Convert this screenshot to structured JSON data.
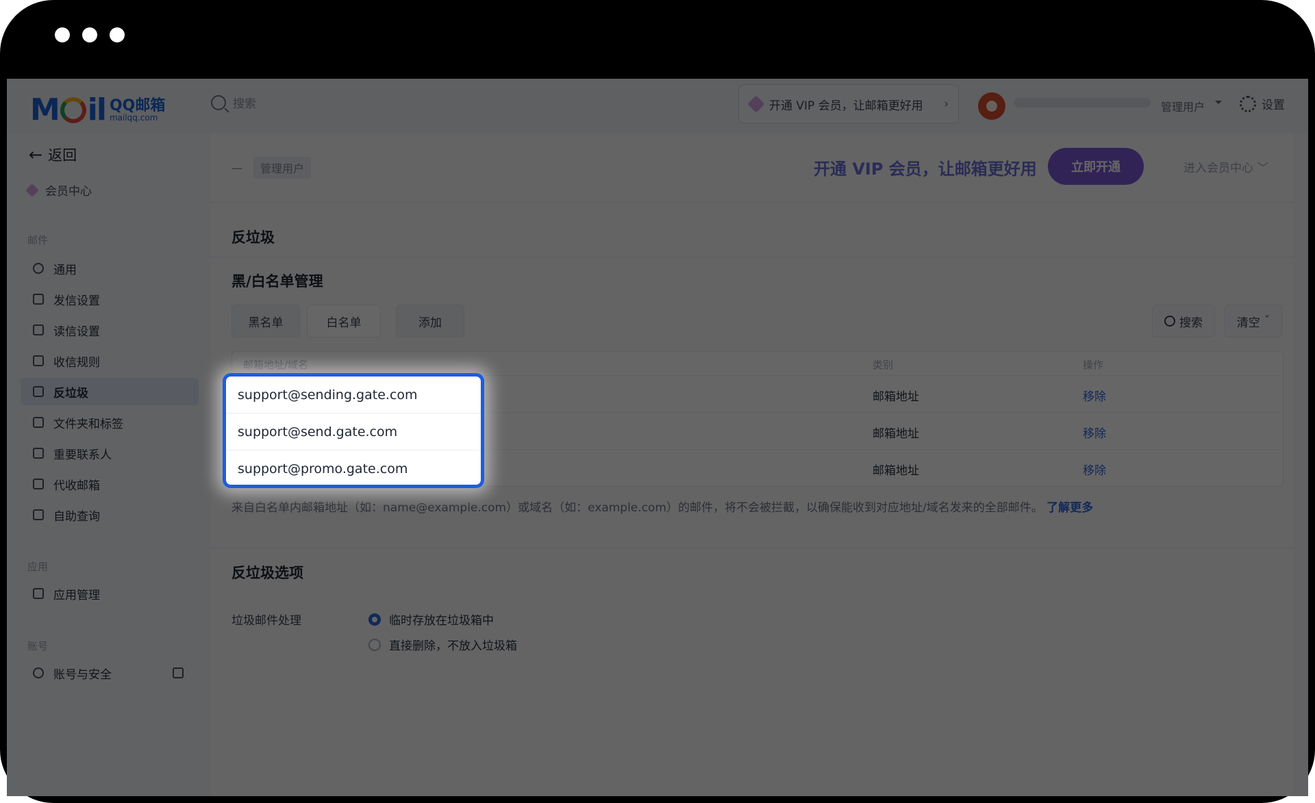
{
  "window": {
    "dots": 3
  },
  "topbar": {
    "logo_text": "M",
    "logo_text_end": "il",
    "logo_qq": "QQ邮箱",
    "logo_sub": "mailqq.com",
    "search_placeholder": "搜索",
    "vip_pill": "开通 VIP 会员，让邮箱更好用",
    "admin_label": "管理用户",
    "settings_label": "设置"
  },
  "sidebar": {
    "back_label": "返回",
    "member_center": "会员中心",
    "sections": {
      "mail": "邮件",
      "apps": "应用",
      "account": "账号"
    },
    "items": [
      {
        "label": "通用"
      },
      {
        "label": "发信设置"
      },
      {
        "label": "读信设置"
      },
      {
        "label": "收信规则"
      },
      {
        "label": "反垃圾"
      },
      {
        "label": "文件夹和标签"
      },
      {
        "label": "重要联系人"
      },
      {
        "label": "代收邮箱"
      },
      {
        "label": "自助查询"
      }
    ],
    "app_items": [
      {
        "label": "应用管理"
      }
    ],
    "account_items": [
      {
        "label": "账号与安全"
      }
    ]
  },
  "main": {
    "breadcrumb": "管理用户",
    "vip_promo": "开通 VIP 会员，让邮箱更好用",
    "vip_button": "立即开通",
    "vip_center": "进入会员中心",
    "page_title": "反垃圾",
    "section_list_title": "黑/白名单管理",
    "tabs": {
      "blacklist": "黑名单",
      "whitelist": "白名单",
      "add": "添加"
    },
    "search_button": "搜索",
    "clear_button": "清空",
    "table": {
      "headers": {
        "address": "邮箱地址/域名",
        "type": "类别",
        "action": "操作"
      },
      "rows": [
        {
          "address": "support@sending.gate.com",
          "type": "邮箱地址",
          "action": "移除"
        },
        {
          "address": "support@send.gate.com",
          "type": "邮箱地址",
          "action": "移除"
        },
        {
          "address": "support@promo.gate.com",
          "type": "邮箱地址",
          "action": "移除"
        }
      ]
    },
    "hint_text": "来自白名单内邮箱地址（如：name@example.com）或域名（如：example.com）的邮件，将不会被拦截，以确保能收到对应地址/域名发来的全部邮件。",
    "hint_link": "了解更多",
    "options_title": "反垃圾选项",
    "spam_handling_label": "垃圾邮件处理",
    "radio_options": [
      {
        "label": "临时存放在垃圾箱中",
        "selected": true
      },
      {
        "label": "直接删除，不放入垃圾箱",
        "selected": false
      }
    ]
  },
  "colors": {
    "accent": "#1e5ce0",
    "vip_purple": "#7a58d8"
  }
}
